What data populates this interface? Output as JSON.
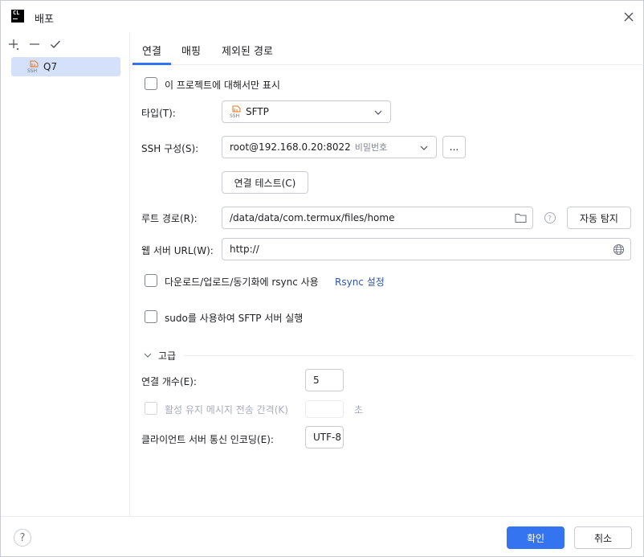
{
  "window": {
    "title": "배포"
  },
  "sidebar": {
    "toolbar": {
      "add_icon": "plus-icon",
      "remove_icon": "minus-icon",
      "check_icon": "check-icon"
    },
    "items": [
      {
        "label": "Q7",
        "icon": "ssh-icon",
        "selected": true
      }
    ]
  },
  "tabs": [
    {
      "label": "연결",
      "active": true
    },
    {
      "label": "매핑",
      "active": false
    },
    {
      "label": "제외된 경로",
      "active": false
    }
  ],
  "form": {
    "only_this_project_label": "이 프로젝트에 대해서만 표시",
    "type": {
      "label": "타입(T):",
      "value": "SFTP"
    },
    "ssh_config": {
      "label": "SSH 구성(S):",
      "value": "root@192.168.0.20:8022",
      "hint": "비밀번호",
      "more_label": "..."
    },
    "test_connection_label": "연결 테스트(C)",
    "root_path": {
      "label": "루트 경로(R):",
      "value": "/data/data/com.termux/files/home",
      "autodetect_label": "자동 탐지"
    },
    "web_url": {
      "label": "웹 서버 URL(W):",
      "value": "http://"
    },
    "rsync": {
      "label": "다운로드/업로드/동기화에 rsync 사용",
      "link": "Rsync 설정"
    },
    "sudo_label": "sudo를 사용하여 SFTP 서버 실행",
    "advanced": {
      "title": "고급",
      "connections": {
        "label": "연결 개수(E):",
        "value": "5"
      },
      "keepalive": {
        "label": "활성 유지 메시지 전송 간격(K)",
        "unit": "초"
      },
      "encoding": {
        "label": "클라이언트 서버 통신 인코딩(E):",
        "value": "UTF-8"
      }
    }
  },
  "footer": {
    "help_label": "?",
    "ok_label": "확인",
    "cancel_label": "취소"
  },
  "colors": {
    "accent": "#3574f0",
    "selection": "#d5e1fb",
    "link": "#2e55a3",
    "ssh_icon": "#e07a1f"
  }
}
